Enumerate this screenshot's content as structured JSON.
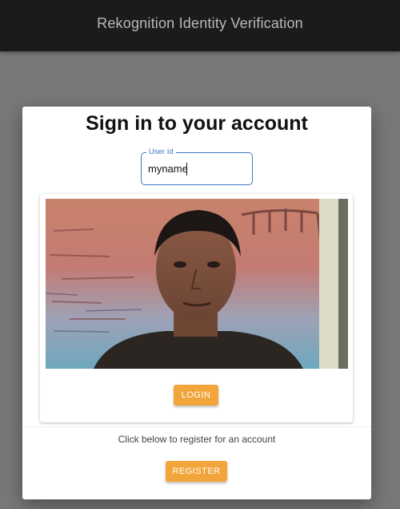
{
  "appbar": {
    "title": "Rekognition Identity Verification"
  },
  "dialog": {
    "heading": "Sign in to your account",
    "user_field": {
      "label": "User Id",
      "value": "myname"
    },
    "camera": {
      "description": "webcam-feed"
    },
    "login_label": "LOGIN",
    "register_prompt": "Click below to register for an account",
    "register_label": "REGISTER"
  },
  "colors": {
    "appbar": "#1b1b1b",
    "backdrop": "#787878",
    "accent_button": "#f2a53a",
    "field_outline": "#3f79c6"
  }
}
